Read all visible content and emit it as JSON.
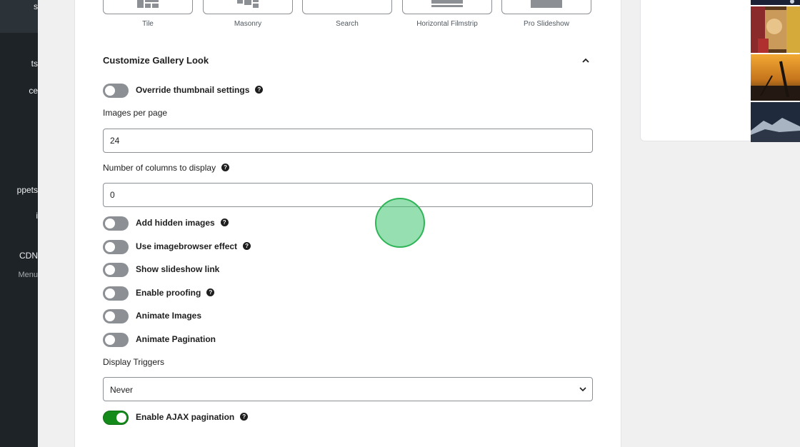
{
  "sidebar": {
    "items": [
      {
        "label": "s"
      },
      {
        "label": "ts"
      },
      {
        "label": "ce"
      },
      {
        "label": "ppets"
      },
      {
        "label": "i"
      },
      {
        "label": "CDN"
      },
      {
        "label": "Menu"
      }
    ]
  },
  "display_types": [
    {
      "label": "Tile",
      "icon": "tile-icon"
    },
    {
      "label": "Masonry",
      "icon": "masonry-icon"
    },
    {
      "label": "Search",
      "icon": "search-layout-icon"
    },
    {
      "label": "Horizontal Filmstrip",
      "icon": "filmstrip-icon"
    },
    {
      "label": "Pro Slideshow",
      "icon": "slideshow-icon"
    }
  ],
  "section": {
    "title": "Customize Gallery Look"
  },
  "toggles": [
    {
      "label": "Override thumbnail settings",
      "on": false,
      "help": true
    },
    {
      "label": "Add hidden images",
      "on": false,
      "help": true
    },
    {
      "label": "Use imagebrowser effect",
      "on": false,
      "help": true
    },
    {
      "label": "Show slideshow link",
      "on": false,
      "help": false
    },
    {
      "label": "Enable proofing",
      "on": false,
      "help": true
    },
    {
      "label": "Animate Images",
      "on": false,
      "help": false
    },
    {
      "label": "Animate Pagination",
      "on": false,
      "help": false
    },
    {
      "label": "Enable AJAX pagination",
      "on": true,
      "help": true
    }
  ],
  "fields": {
    "images_per_page": {
      "label": "Images per page",
      "value": "24"
    },
    "columns": {
      "label": "Number of columns to display",
      "value": "0"
    },
    "display_triggers": {
      "label": "Display Triggers",
      "value": "Never"
    }
  },
  "colors": {
    "toggle_on": "#138a1a",
    "toggle_off": "#8c8f94",
    "sidebar": "#1d2327",
    "cursor": "#2fb457"
  },
  "help_glyph": "?"
}
